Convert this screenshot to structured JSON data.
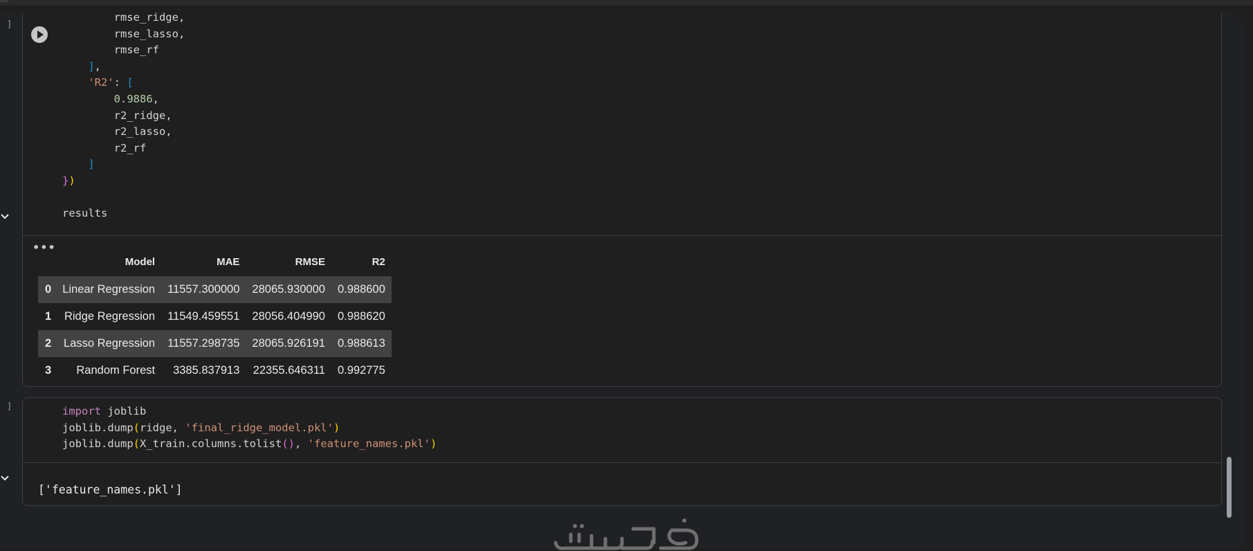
{
  "cell1": {
    "gutter_label": "]",
    "code_tail": {
      "line1": "rmse_ridge,",
      "line2": "rmse_lasso,",
      "line3": "rmse_rf",
      "line4_bracket": "]",
      "line4_comma": ",",
      "r2_key": "'R2'",
      "r2_colon": ": ",
      "r2_open": "[",
      "r2_first": "0.9886",
      "r2_first_comma": ",",
      "r2_ridge": "r2_ridge,",
      "r2_lasso": "r2_lasso,",
      "r2_rf": "r2_rf",
      "close_bracket": "]",
      "close_brace": "}",
      "close_paren": ")",
      "results": "results"
    },
    "output": {
      "menu_glyph": "•••",
      "table": {
        "columns": [
          "",
          "Model",
          "MAE",
          "RMSE",
          "R2"
        ],
        "rows": [
          {
            "index": "0",
            "model": "Linear Regression",
            "mae": "11557.300000",
            "rmse": "28065.930000",
            "r2": "0.988600"
          },
          {
            "index": "1",
            "model": "Ridge Regression",
            "mae": "11549.459551",
            "rmse": "28056.404990",
            "r2": "0.988620"
          },
          {
            "index": "2",
            "model": "Lasso Regression",
            "mae": "11557.298735",
            "rmse": "28065.926191",
            "r2": "0.988613"
          },
          {
            "index": "3",
            "model": "Random Forest",
            "mae": "3385.837913",
            "rmse": "22355.646311",
            "r2": "0.992775"
          }
        ]
      }
    }
  },
  "cell2": {
    "gutter_label": "]",
    "code": {
      "import_kw": "import",
      "import_rest": " joblib",
      "l2_a": "joblib.dump",
      "l2_open": "(",
      "l2_b": "ridge, ",
      "l2_str": "'final_ridge_model.pkl'",
      "l2_close": ")",
      "l3_a": "joblib.dump",
      "l3_open": "(",
      "l3_b": "X_train.columns.tolist",
      "l3_inner": "()",
      "l3_c": ", ",
      "l3_str": "'feature_names.pkl'",
      "l3_close": ")"
    },
    "output_text": "['feature_names.pkl']"
  },
  "colors": {
    "background": "#1f1f1f",
    "keyword": "#c586c0",
    "string": "#ce9178",
    "number": "#b5cea8",
    "bracket_blue": "#1f8ad2",
    "bracket_pink": "#da70d6",
    "bracket_gold": "#ffd700",
    "table_stripe": "#424242"
  },
  "icons": [
    "run-cell-icon",
    "collapse-output-icon",
    "output-menu-icon",
    "watermark-logo"
  ]
}
